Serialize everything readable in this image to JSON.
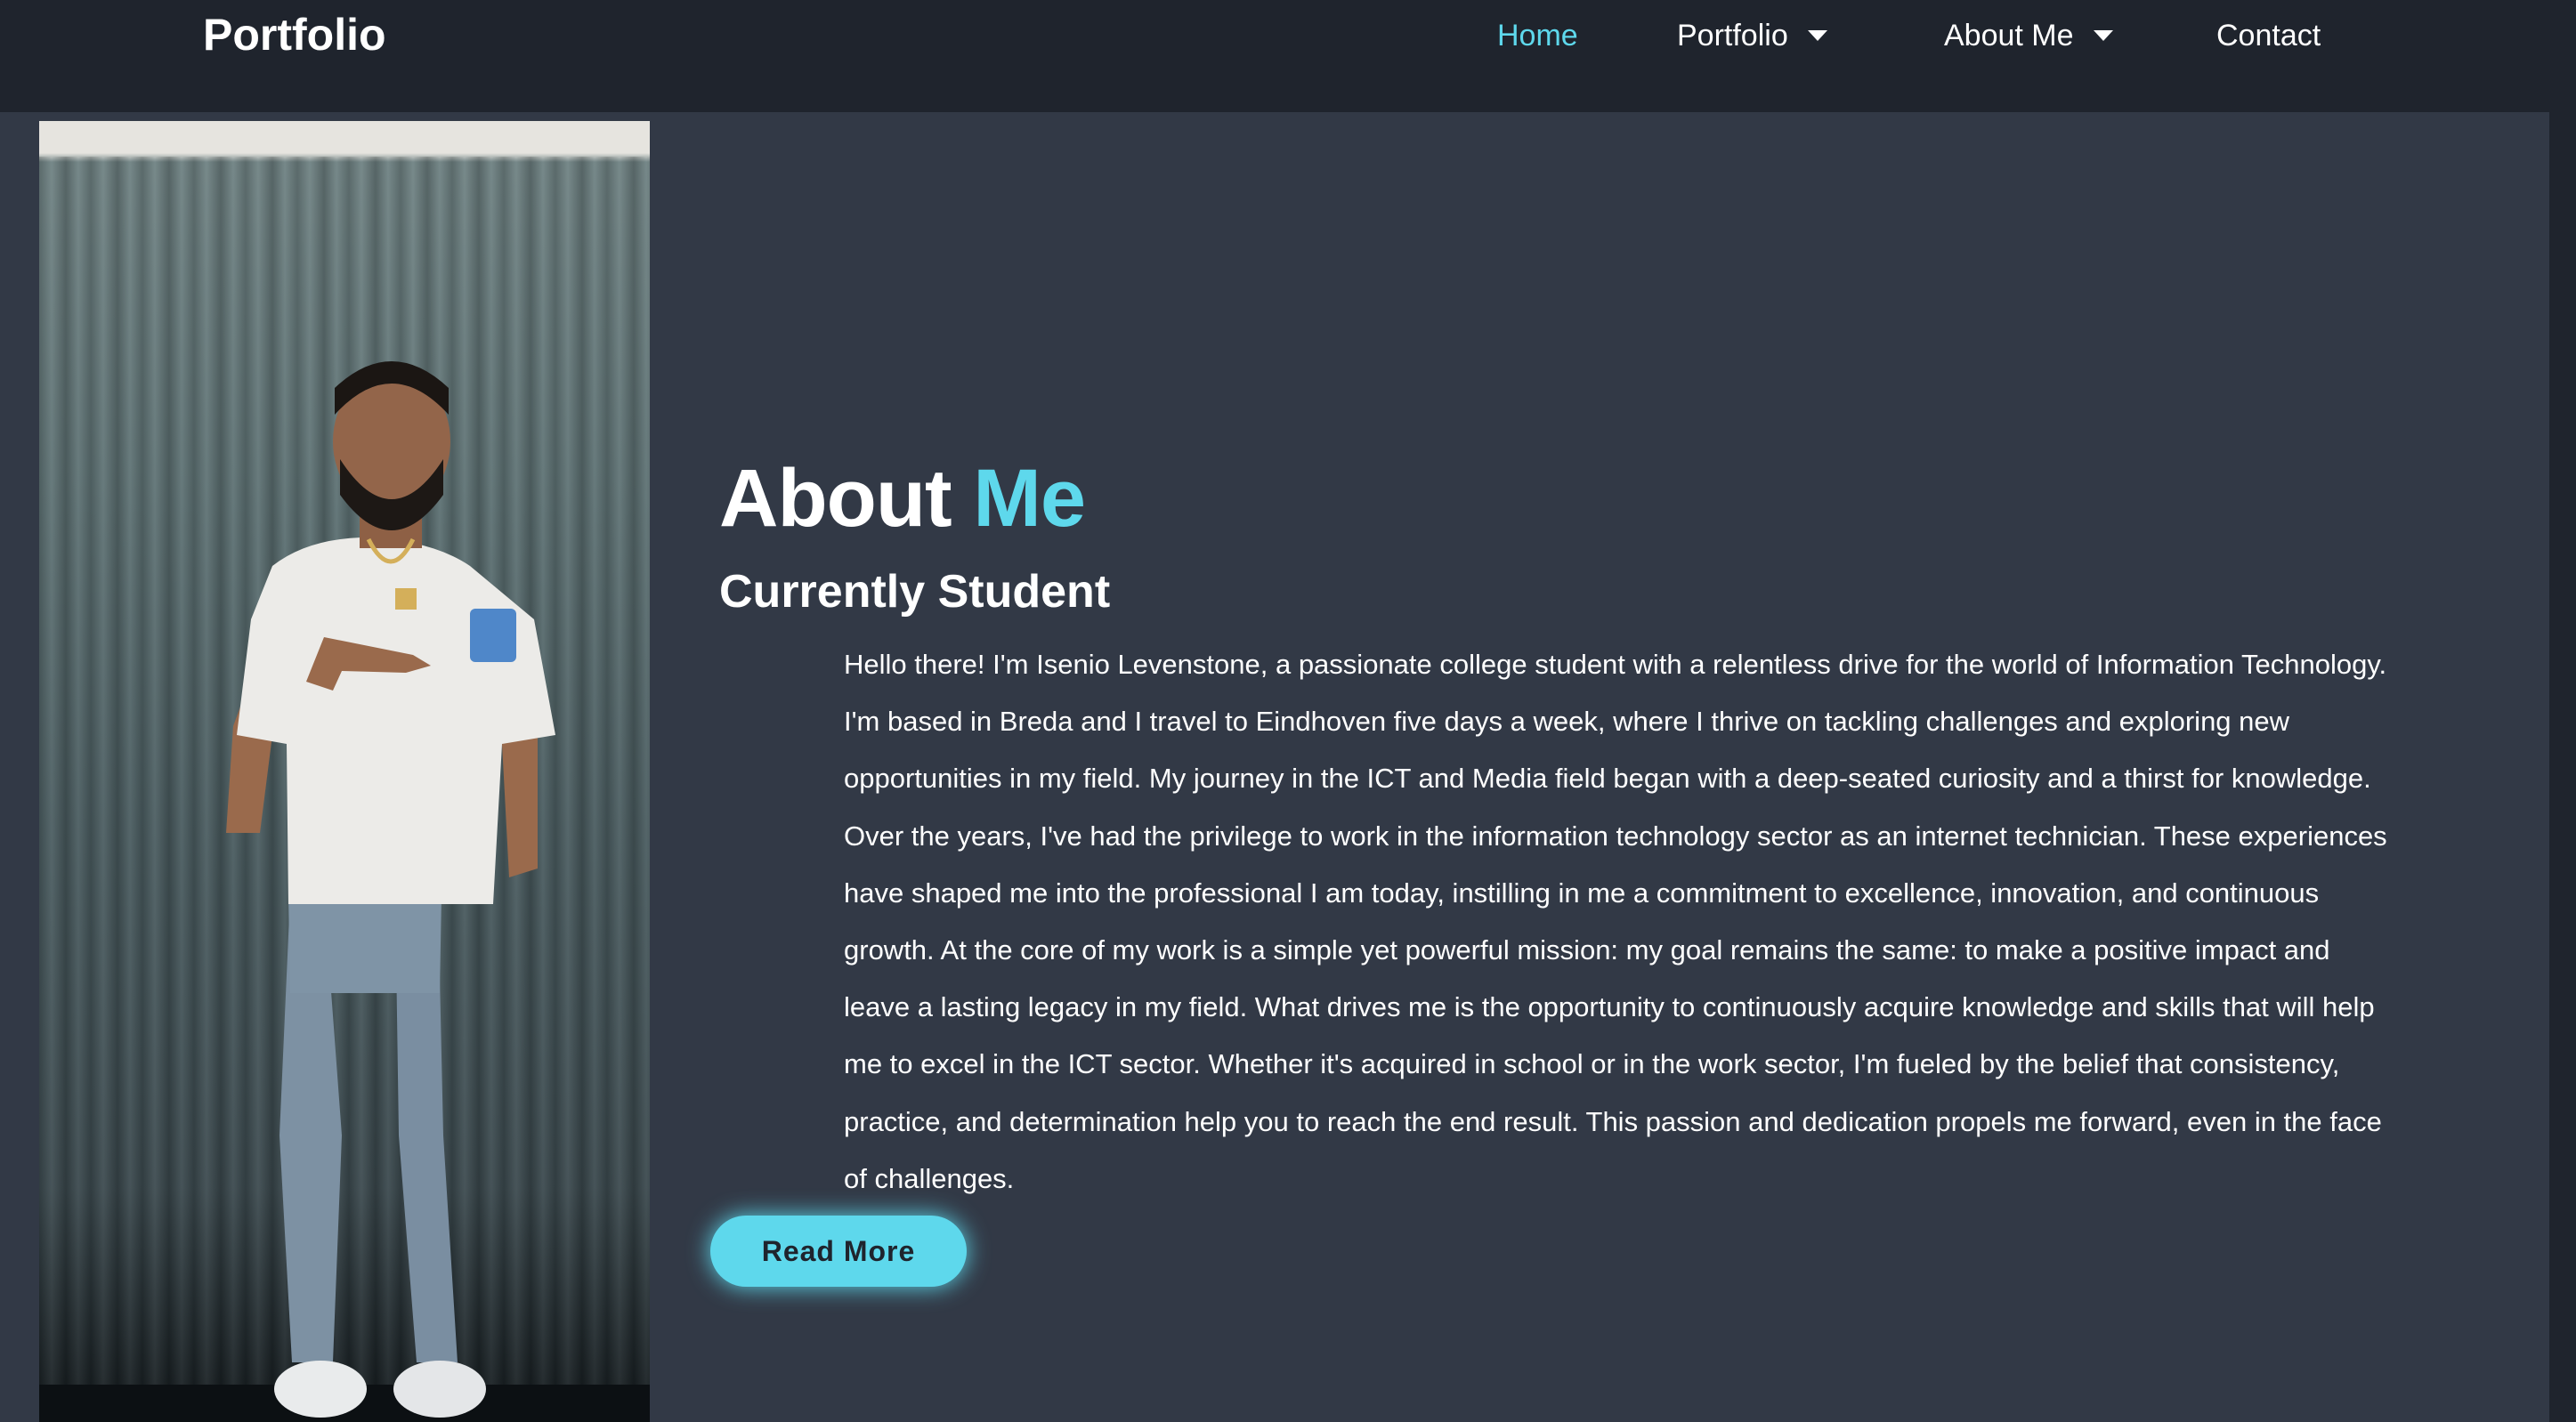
{
  "nav": {
    "brand": "Portfolio",
    "items": [
      {
        "label": "Home",
        "active": true,
        "has_dropdown": false
      },
      {
        "label": "Portfolio",
        "active": false,
        "has_dropdown": true
      },
      {
        "label": "About Me",
        "active": false,
        "has_dropdown": true
      },
      {
        "label": "Contact",
        "active": false,
        "has_dropdown": false
      }
    ]
  },
  "about": {
    "heading_part1": "About",
    "heading_part2": "Me",
    "subheading": "Currently Student",
    "bio": "Hello there! I'm Isenio Levenstone, a passionate college student with a relentless drive for the world of Information Technology. I'm based in Breda and I travel to Eindhoven five days a week, where I thrive on tackling challenges and exploring new opportunities in my field. My journey in the ICT and Media field began with a deep-seated curiosity and a thirst for knowledge. Over the years, I've had the privilege to work in the information technology sector as an internet technician. These experiences have shaped me into the professional I am today, instilling in me a commitment to excellence, innovation, and continuous growth. At the core of my work is a simple yet powerful mission: my goal remains the same: to make a positive impact and leave a lasting legacy in my field. What drives me is the opportunity to continuously acquire knowledge and skills that will help me to excel in the ICT sector. Whether it's acquired in school or in the work sector, I'm fueled by the belief that consistency, practice, and determination help you to reach the end result. This passion and dedication propels me forward, even in the face of challenges.",
    "button_label": "Read More"
  },
  "colors": {
    "accent": "#5ed8ec",
    "navbar_bg": "#1f242d",
    "content_bg": "#323946",
    "text": "#ffffff"
  }
}
